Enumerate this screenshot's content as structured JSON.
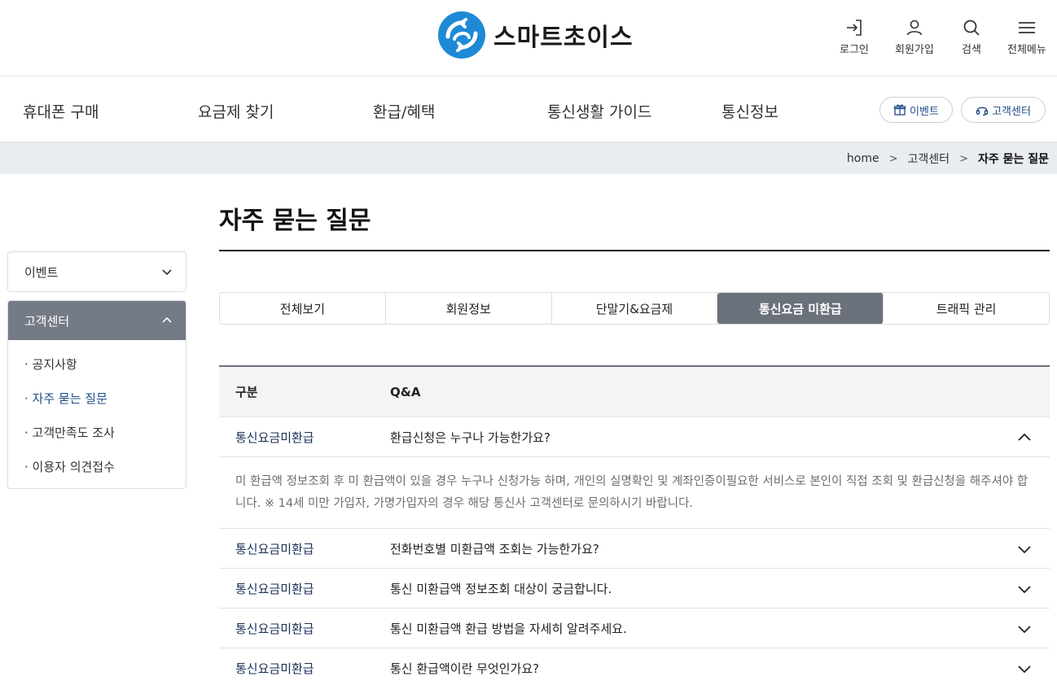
{
  "brand": {
    "name": "스마트초이스",
    "accent": "#1e8ad6"
  },
  "util": [
    {
      "label": "로그인",
      "icon": "login-icon"
    },
    {
      "label": "회원가입",
      "icon": "user-icon"
    },
    {
      "label": "검색",
      "icon": "search-icon"
    },
    {
      "label": "전체메뉴",
      "icon": "menu-icon"
    }
  ],
  "gnb": {
    "items": [
      "휴대폰 구매",
      "요금제 찾기",
      "환급/혜택",
      "통신생활 가이드",
      "통신정보"
    ],
    "event_label": "이벤트",
    "support_label": "고객센터"
  },
  "breadcrumb": {
    "home": "home",
    "section": "고객센터",
    "current": "자주 묻는 질문"
  },
  "page_title": "자주 묻는 질문",
  "sidebar": {
    "event": {
      "label": "이벤트"
    },
    "support": {
      "label": "고객센터",
      "items": [
        "· 공지사항",
        "· 자주 묻는 질문",
        "· 고객만족도 조사",
        "· 이용자 의견접수"
      ]
    }
  },
  "tabs": [
    "전체보기",
    "회원정보",
    "단말기&요금제",
    "통신요금 미환급",
    "트래픽 관리"
  ],
  "faq": {
    "head": {
      "category": "구분",
      "qa": "Q&A"
    },
    "open": {
      "category": "통신요금미환급",
      "question": "환급신청은 누구나 가능한가요?",
      "answer": "미 환급액 정보조회 후 미 환급액이 있을 경우 누구나 신청가능 하며, 개인의 실명확인 및 계좌인증이필요한 서비스로 본인이 직접 조회 및 환급신청을 해주셔야 합니다. ※ 14세 미만 가입자, 가명가입자의 경우 해당 통신사 고객센터로 문의하시기 바랍니다."
    },
    "rows": [
      {
        "category": "통신요금미환급",
        "question": "전화번호별 미환급액 조회는 가능한가요?"
      },
      {
        "category": "통신요금미환급",
        "question": "통신 미환급액 정보조회 대상이 궁금합니다."
      },
      {
        "category": "통신요금미환급",
        "question": "통신 미환급액 환급 방법을 자세히 알려주세요."
      },
      {
        "category": "통신요금미환급",
        "question": "통신 환급액이란 무엇인가요?"
      }
    ]
  }
}
